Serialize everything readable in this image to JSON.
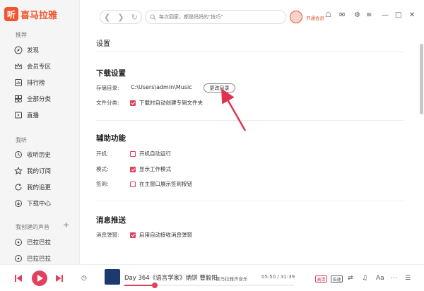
{
  "app": {
    "logo_text": "喜马拉雅",
    "logo_mark": "听"
  },
  "sidebar": {
    "section_recommend": "推荐",
    "recommend_items": [
      {
        "label": "发现",
        "icon": "compass-icon"
      },
      {
        "label": "会员专区",
        "icon": "vip-crown-icon"
      },
      {
        "label": "排行榜",
        "icon": "ranking-icon"
      },
      {
        "label": "全部分类",
        "icon": "category-icon"
      },
      {
        "label": "直播",
        "icon": "live-icon"
      }
    ],
    "section_mine": "我听",
    "mine_items": [
      {
        "label": "收听历史",
        "icon": "history-icon"
      },
      {
        "label": "我的订阅",
        "icon": "star-icon"
      },
      {
        "label": "我的追更",
        "icon": "refresh-icon"
      },
      {
        "label": "下载中心",
        "icon": "download-icon"
      }
    ],
    "section_created": "我创建的声音",
    "created_add": "+",
    "created_items": [
      {
        "label": "巴拉巴拉",
        "icon": "album-icon"
      },
      {
        "label": "巴拉巴拉",
        "icon": "album-icon"
      }
    ]
  },
  "header": {
    "search_placeholder": "每次回家，都是妈妈的\"技巧\"",
    "vip_label": "开通会员"
  },
  "settings": {
    "title": "设置",
    "download": {
      "heading": "下载设置",
      "dir_label": "存储目录:",
      "dir_path": "C:\\Users\\admin\\Music",
      "change_button": "更改目录",
      "category_label": "文件分类:",
      "category_option": "下载时自动创建专辑文件夹",
      "category_checked": true
    },
    "assist": {
      "heading": "辅助功能",
      "startup_label": "开机:",
      "startup_option": "开机自动运行",
      "startup_checked": false,
      "mode_label": "模式:",
      "mode_option": "显示工作模式",
      "mode_checked": true,
      "signin_label": "签到:",
      "signin_option": "在主窗口展示签到按钮",
      "signin_checked": false
    },
    "push": {
      "heading": "消息推送",
      "popup_label": "消息弹窗:",
      "popup_option": "启用自动接收消息弹窗",
      "popup_checked": true
    }
  },
  "player": {
    "track": "Day 364《语言学家》炳饼 曹毅阳",
    "artist": "喜马拉雅声音乐",
    "time": "05:50 / 31:39",
    "progress": 0.18,
    "tag_quality": "高清",
    "tag_speed": "倍速",
    "text_icon": "Aa"
  },
  "colors": {
    "accent": "#e0415f",
    "brand": "#f0552e",
    "arrow": "#e0334f"
  }
}
